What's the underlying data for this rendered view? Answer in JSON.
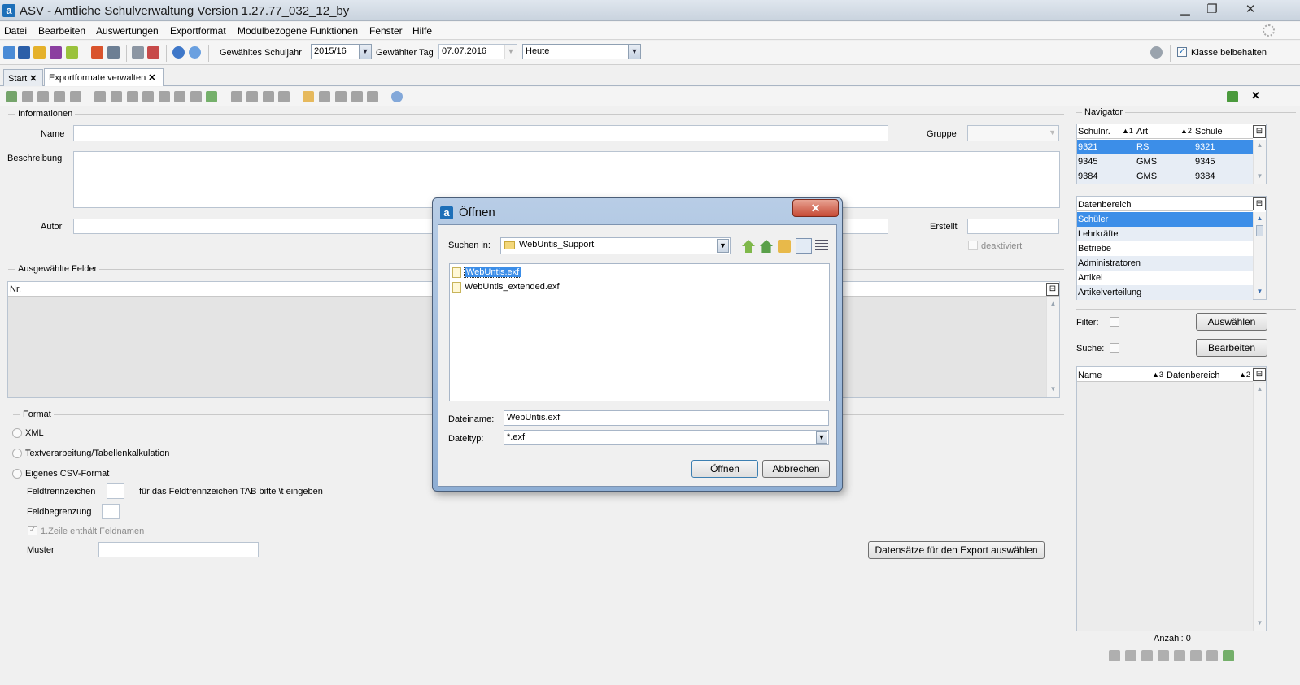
{
  "window": {
    "title": "ASV - Amtliche Schulverwaltung Version 1.27.77_032_12_by",
    "logo": "a",
    "minimize": "▁",
    "maximize": "❐",
    "close": "✕"
  },
  "menu": [
    "Datei",
    "Bearbeiten",
    "Auswertungen",
    "Exportformat",
    "Modulbezogene Funktionen",
    "Fenster",
    "Hilfe"
  ],
  "toolbar": {
    "schuljahr_label": "Gewähltes Schuljahr",
    "schuljahr_value": "2015/16",
    "tag_label": "Gewählter Tag",
    "tag_value": "07.07.2016",
    "heute_value": "Heute",
    "klasse_label": "Klasse beibehalten",
    "combo_arrow": "▼"
  },
  "tabs": [
    {
      "label": "Start",
      "close": "✕"
    },
    {
      "label": "Exportformate verwalten",
      "close": "✕"
    }
  ],
  "form": {
    "informationen": "Informationen",
    "name_label": "Name",
    "gruppe_label": "Gruppe",
    "beschreibung_label": "Beschreibung",
    "autor_label": "Autor",
    "erstellt_label": "Erstellt",
    "deaktiviert_label": "deaktiviert",
    "ausgewaehlte_felder": "Ausgewählte Felder",
    "grid_header_nr": "Nr.",
    "format_title": "Format",
    "format_options": [
      "XML",
      "Textverarbeitung/Tabellenkalkulation",
      "Eigenes CSV-Format"
    ],
    "feldtrennzeichen_label": "Feldtrennzeichen",
    "feldtrennzeichen_hint": "für das Feldtrennzeichen TAB bitte \\t eingeben",
    "feldbegrenzung_label": "Feldbegrenzung",
    "erste_zeile_label": "1.Zeile enthält Feldnamen",
    "muster_label": "Muster",
    "export_button": "Datensätze für den Export auswählen"
  },
  "navigator": {
    "title": "Navigator",
    "schulen_headers": [
      "Schulnr.",
      "Art",
      "Schule"
    ],
    "schulen_sort": [
      "▲1",
      "▲2"
    ],
    "schulen_rows": [
      [
        "9321",
        "RS",
        "9321"
      ],
      [
        "9345",
        "GMS",
        "9345"
      ],
      [
        "9384",
        "GMS",
        "9384"
      ]
    ],
    "datenbereich_header": "Datenbereich",
    "datenbereiche": [
      "Schüler",
      "Lehrkräfte",
      "Betriebe",
      "Administratoren",
      "Artikel",
      "Artikelverteilung"
    ],
    "filter_label": "Filter:",
    "suche_label": "Suche:",
    "auswaehlen_button": "Auswählen",
    "bearbeiten_button": "Bearbeiten",
    "result_headers": [
      "Name",
      "Datenbereich"
    ],
    "result_sort": [
      "▲3",
      "▲2"
    ],
    "anzahl": "Anzahl: 0"
  },
  "dialog": {
    "title": "Öffnen",
    "close": "✕",
    "suchen_in_label": "Suchen in:",
    "suchen_in_value": "WebUntis_Support",
    "files": [
      "WebUntis.exf",
      "WebUntis_extended.exf"
    ],
    "dateiname_label": "Dateiname:",
    "dateiname_value": "WebUntis.exf",
    "dateityp_label": "Dateityp:",
    "dateityp_value": "*.exf",
    "open_button": "Öffnen",
    "cancel_button": "Abbrechen"
  },
  "colors": {
    "selection": "#3c8ee8",
    "dialog_frame": "#8eaed4",
    "close_red": "#c64a35"
  }
}
